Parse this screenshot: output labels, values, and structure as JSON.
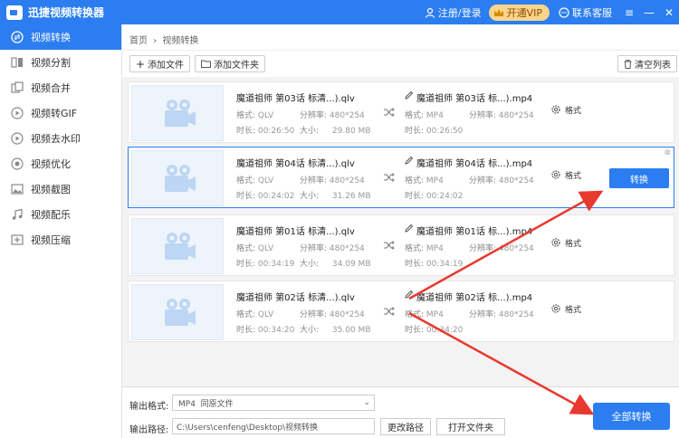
{
  "app": {
    "title": "迅捷视频转换器"
  },
  "titlebar": {
    "login": "注册/登录",
    "vip": "开通VIP",
    "service": "联系客服",
    "menu": "≡",
    "minimize": "—",
    "close": "✕"
  },
  "sidebar": {
    "items": [
      {
        "label": "视频转换",
        "icon": "convert-icon"
      },
      {
        "label": "视频分割",
        "icon": "split-icon"
      },
      {
        "label": "视频合并",
        "icon": "merge-icon"
      },
      {
        "label": "视频转GIF",
        "icon": "gif-icon"
      },
      {
        "label": "视频去水印",
        "icon": "watermark-icon"
      },
      {
        "label": "视频优化",
        "icon": "optimize-icon"
      },
      {
        "label": "视频截图",
        "icon": "screenshot-icon"
      },
      {
        "label": "视频配乐",
        "icon": "music-icon"
      },
      {
        "label": "视频压缩",
        "icon": "compress-icon"
      }
    ]
  },
  "breadcrumb": {
    "home": "首页",
    "sep": "›",
    "current": "视频转换"
  },
  "toolbar": {
    "add_file": "添加文件",
    "add_folder": "添加文件夹",
    "clear": "清空列表"
  },
  "labels": {
    "format": "格式:",
    "resolution": "分辨率:",
    "duration": "时长:",
    "size": "大小:",
    "settings": "格式",
    "convert": "转换"
  },
  "files": [
    {
      "src_name": "魔道祖师 第03话 标清...).qlv",
      "src_format": "QLV",
      "src_res": "480*254",
      "src_duration": "00:26:50",
      "src_size": "29.80 MB",
      "dst_name": "魔道祖师 第03话 标...).mp4",
      "dst_format": "MP4",
      "dst_res": "480*254",
      "dst_duration": "00:26:50"
    },
    {
      "src_name": "魔道祖师 第04话 标清...).qlv",
      "src_format": "QLV",
      "src_res": "480*254",
      "src_duration": "00:24:02",
      "src_size": "31.26 MB",
      "dst_name": "魔道祖师 第04话 标...).mp4",
      "dst_format": "MP4",
      "dst_res": "480*254",
      "dst_duration": "00:24:02"
    },
    {
      "src_name": "魔道祖师 第01话 标清...).qlv",
      "src_format": "QLV",
      "src_res": "480*254",
      "src_duration": "00:34:19",
      "src_size": "34.09 MB",
      "dst_name": "魔道祖师 第01话 标...).mp4",
      "dst_format": "MP4",
      "dst_res": "480*254",
      "dst_duration": "00:34:19"
    },
    {
      "src_name": "魔道祖师 第02话 标清...).qlv",
      "src_format": "QLV",
      "src_res": "480*254",
      "src_duration": "00:34:20",
      "src_size": "35.00 MB",
      "dst_name": "魔道祖师 第02话 标...).mp4",
      "dst_format": "MP4",
      "dst_res": "480*254",
      "dst_duration": "00:34:20"
    }
  ],
  "output": {
    "format_label": "输出格式:",
    "format_value": "MP4  同原文件",
    "path_label": "输出路径:",
    "path_value": "C:\\Users\\cenfeng\\Desktop\\视频转换",
    "change_path": "更改路径",
    "open_folder": "打开文件夹",
    "convert_all": "全部转换"
  },
  "colors": {
    "accent": "#2b7df0",
    "vip": "#fbd58b",
    "annotation": "#e8392f"
  }
}
